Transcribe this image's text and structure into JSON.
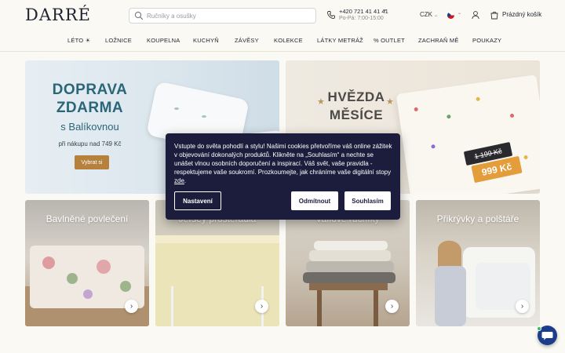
{
  "header": {
    "logo": "DARRÉ",
    "search_placeholder": "Ručníky a osušky",
    "phone": "+420 721 41 41 41",
    "hours": "Po-Pá: 7:00-15:00",
    "currency": "CZK",
    "cart_label": "Prázdný košík"
  },
  "nav": {
    "items": [
      "LÉTO ☀",
      "LOŽNICE",
      "KOUPELNA",
      "KUCHYŇ",
      "ZÁVĚSY",
      "KOLEKCE",
      "LÁTKY METRÁŽ",
      "% OUTLET",
      "ZACHRAŇ MĚ",
      "POUKAZY"
    ]
  },
  "banners": {
    "left": {
      "title_line1": "DOPRAVA",
      "title_line2": "ZDARMA",
      "subtitle": "s Balíkovnou",
      "note": "při nákupu nad 749 Kč",
      "button": "Vybrat si"
    },
    "right": {
      "title_line1": "HVĚZDA",
      "title_line2": "MĚSÍCE",
      "old_price": "1 199 Kč",
      "new_price": "999 Kč"
    }
  },
  "categories": [
    {
      "title": "Bavlněné povlečení"
    },
    {
      "title": "Jersey prostěradla"
    },
    {
      "title": "Vaflové ručníky"
    },
    {
      "title": "Přikrývky a polštáře"
    }
  ],
  "cookie": {
    "text": "Vstupte do světa pohodlí a stylu! Našimi cookies přetvoříme váš online zážitek v objevování dokonalých produktů. Klikněte na „Souhlasím“ a nechte se unášet vlnou osobních doporučení a inspirací. Váš svět, vaše pravidla - respektujeme vaše soukromí. Prozkoumejte, jak chráníme vaše digitální stopy",
    "link": "zde",
    "buttons": {
      "settings": "Nastavení",
      "decline": "Odmítnout",
      "accept": "Souhlasím"
    }
  },
  "colors": {
    "brand_navy": "#1c1d3c",
    "accent_gold": "#b5813c",
    "sale_orange": "#e39d3a",
    "chat_blue": "#1c3c8c"
  }
}
